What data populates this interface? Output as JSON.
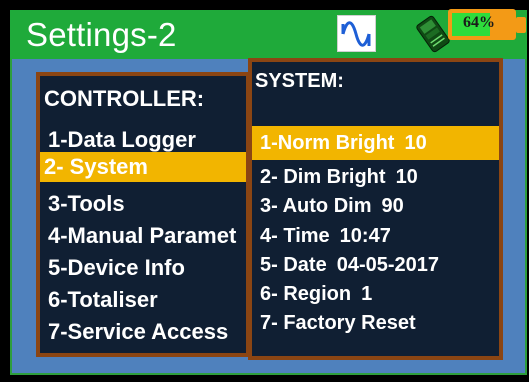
{
  "title": "Settings-2",
  "battery": {
    "label": "64%",
    "level": 0.64
  },
  "icons": {
    "wave": "sine-wave-icon",
    "bluetooth": "bluetooth-module-icon",
    "battery": "battery-icon"
  },
  "colors": {
    "title_bar": "#1faa3a",
    "background": "#4f81bd",
    "panel": "#101f33",
    "panel_border": "#8b4513",
    "selected": "#f2b500",
    "battery_frame": "#f39a16",
    "battery_fill": "#2edc3c"
  },
  "controller": {
    "heading": "CONTROLLER:",
    "items": [
      {
        "label": "1-Data Logger"
      },
      {
        "label": "2- System",
        "selected": true
      },
      {
        "label": "3-Tools"
      },
      {
        "label": "4-Manual Paramet"
      },
      {
        "label": "5-Device Info"
      },
      {
        "label": "6-Totaliser"
      },
      {
        "label": "7-Service Access"
      }
    ]
  },
  "system": {
    "heading": "SYSTEM:",
    "items": [
      {
        "label": "1-Norm Bright",
        "value": "10",
        "selected": true
      },
      {
        "label": "2- Dim Bright",
        "value": "10"
      },
      {
        "label": "3- Auto Dim",
        "value": "90"
      },
      {
        "label": "4- Time",
        "value": "10:47"
      },
      {
        "label": "5- Date",
        "value": "04-05-2017"
      },
      {
        "label": "6- Region",
        "value": "1"
      },
      {
        "label": "7- Factory Reset",
        "value": ""
      }
    ]
  }
}
